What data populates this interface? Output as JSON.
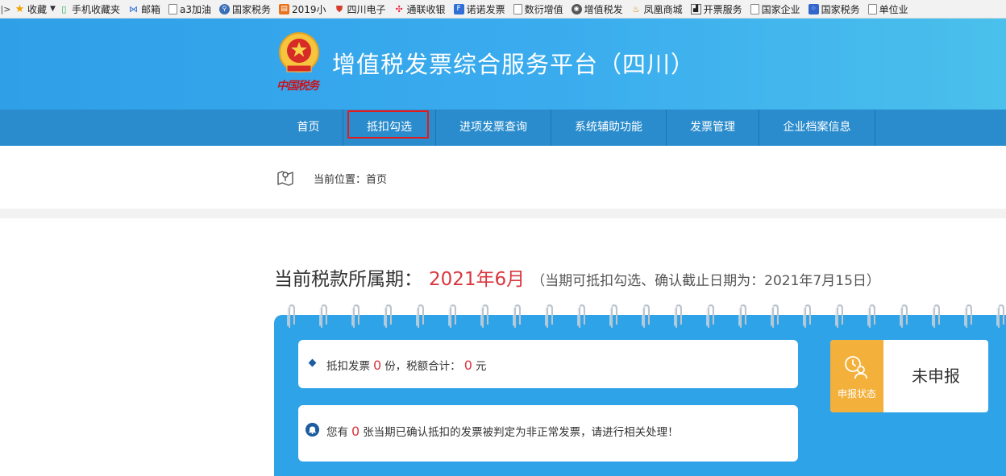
{
  "bookmarks": [
    {
      "label": "收藏",
      "icon": "star-icon"
    },
    {
      "label": "手机收藏夹",
      "icon": "phone-icon"
    },
    {
      "label": "邮箱",
      "icon": "mail-icon"
    },
    {
      "label": "a3加油",
      "icon": "document-icon"
    },
    {
      "label": "国家税务",
      "icon": "search-globe-icon"
    },
    {
      "label": "2019小",
      "icon": "calendar-icon"
    },
    {
      "label": "四川电子",
      "icon": "tax-emblem-icon"
    },
    {
      "label": "通联收银",
      "icon": "pinwheel-icon"
    },
    {
      "label": "诺诺发票",
      "icon": "nuonuo-icon"
    },
    {
      "label": "数衍增值",
      "icon": "document-icon"
    },
    {
      "label": "增值税发",
      "icon": "tax-seal-icon"
    },
    {
      "label": "凤凰商城",
      "icon": "phoenix-icon"
    },
    {
      "label": "开票服务",
      "icon": "image-icon"
    },
    {
      "label": "国家企业",
      "icon": "document-icon"
    },
    {
      "label": "国家税务",
      "icon": "baidu-icon"
    },
    {
      "label": "单位业",
      "icon": "document-icon"
    }
  ],
  "header": {
    "emblem_text": "中国税务",
    "title": "增值税发票综合服务平台（四川）"
  },
  "nav": {
    "items": [
      {
        "label": "首页",
        "width": 86
      },
      {
        "label": "抵扣勾选",
        "width": 115,
        "active": true
      },
      {
        "label": "进项发票查询",
        "width": 143
      },
      {
        "label": "系统辅助功能",
        "width": 143
      },
      {
        "label": "发票管理",
        "width": 115
      },
      {
        "label": "企业档案信息",
        "width": 144
      }
    ]
  },
  "breadcrumb": {
    "text": "当前位置：首页"
  },
  "period": {
    "label": "当前税款所属期：",
    "value": "2021年6月",
    "note": "（当期可抵扣勾选、确认截止日期为：2021年7月15日）"
  },
  "summary": {
    "prefix": "抵扣发票",
    "count": "0",
    "count_unit": "份，税额合计：",
    "amount": "0",
    "amount_unit": "元"
  },
  "alert": {
    "prefix": "您有",
    "count": "0",
    "suffix": "张当期已确认抵扣的发票被判定为非正常发票，请进行相关处理！"
  },
  "status": {
    "label": "申报状态",
    "value": "未申报"
  },
  "colors": {
    "header_blue": "#2f9fe8",
    "nav_blue": "#2a8ccd",
    "accent_red": "#d9363e",
    "status_orange": "#f3b03a"
  }
}
